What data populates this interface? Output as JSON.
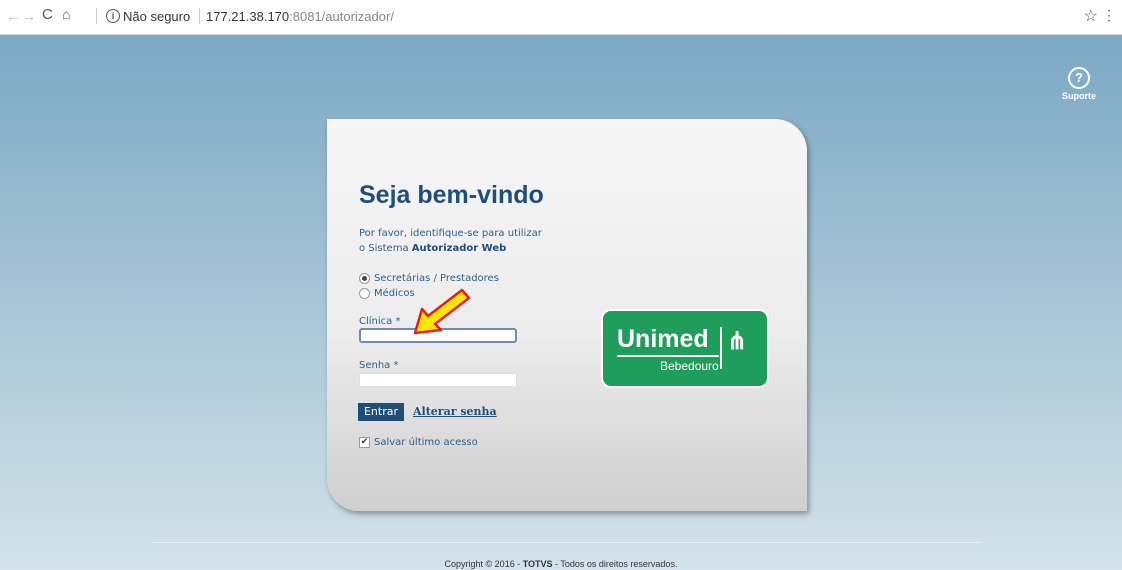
{
  "browser": {
    "security_label": "Não seguro",
    "url_host": "177.21.38.170",
    "url_path": ":8081/autorizador/",
    "back_icon": "←",
    "forward_icon": "→",
    "reload_icon": "C",
    "home_icon": "⌂",
    "star_icon": "☆",
    "menu_icon": "⋮"
  },
  "support": {
    "icon": "?",
    "label": "Suporte"
  },
  "login": {
    "title": "Seja bem-vindo",
    "intro_line1": "Por favor, identifique-se para utilizar",
    "intro_line2_prefix": "o Sistema ",
    "intro_line2_bold": "Autorizador Web",
    "user_types": [
      {
        "label": "Secretárias / Prestadores",
        "selected": true
      },
      {
        "label": "Médicos",
        "selected": false
      }
    ],
    "clinica_label": "Clínica *",
    "clinica_value": "",
    "senha_label": "Senha *",
    "senha_value": "",
    "submit_label": "Entrar",
    "change_password_link": "Alterar senha",
    "save_access_label": "Salvar último acesso",
    "save_access_checked": true
  },
  "logo": {
    "brand": "Unimed",
    "city": "Bebedouro",
    "color": "#1e9e5a"
  },
  "annotation": {
    "arrow_color": "#ffe600",
    "arrow_outline": "#e02020"
  },
  "footer": {
    "prefix": "Copyright © 2016 - ",
    "company": "TOTVS",
    "suffix": " - Todos os direitos reservados."
  }
}
